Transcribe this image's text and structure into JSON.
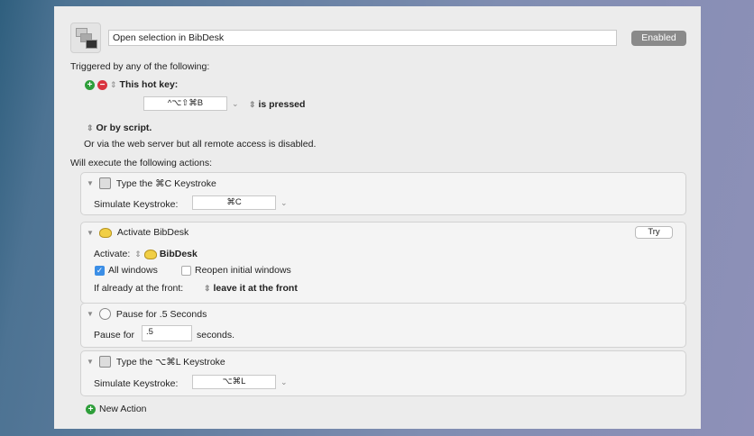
{
  "macro": {
    "name": "Open selection in BibDesk",
    "enabled_label": "Enabled"
  },
  "triggers": {
    "heading": "Triggered by any of the following:",
    "hotkey_label": "This hot key:",
    "hotkey_value": "^⌥⇧⌘B",
    "is_pressed": "is pressed",
    "by_script": "Or by script.",
    "web_server": "Or via the web server but all remote access is disabled."
  },
  "actions_heading": "Will execute the following actions:",
  "actions": [
    {
      "title": "Type the ⌘C Keystroke",
      "label": "Simulate Keystroke:",
      "value": "⌘C"
    },
    {
      "title": "Activate BibDesk",
      "try_label": "Try",
      "activate_label": "Activate:",
      "app": "BibDesk",
      "all_windows": "All windows",
      "all_windows_checked": true,
      "reopen": "Reopen initial windows",
      "reopen_checked": false,
      "front_label": "If already at the front:",
      "front_value": "leave it at the front"
    },
    {
      "title": "Pause for .5 Seconds",
      "label": "Pause for",
      "value": ".5",
      "unit": "seconds."
    },
    {
      "title": "Type the ⌥⌘L Keystroke",
      "label": "Simulate Keystroke:",
      "value": "⌥⌘L"
    }
  ],
  "new_action": "New Action",
  "colors": {
    "add": "#2e9e3a",
    "remove": "#d9333f",
    "checkbox": "#3b8ee6"
  }
}
